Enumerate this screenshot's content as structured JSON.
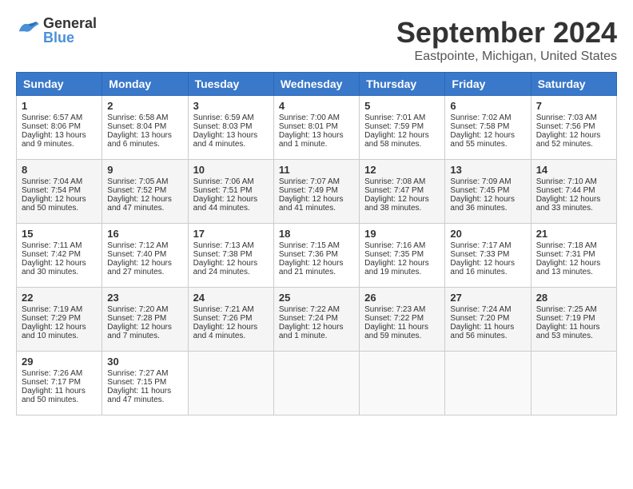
{
  "header": {
    "logo_general": "General",
    "logo_blue": "Blue",
    "month_title": "September 2024",
    "location": "Eastpointe, Michigan, United States"
  },
  "days_of_week": [
    "Sunday",
    "Monday",
    "Tuesday",
    "Wednesday",
    "Thursday",
    "Friday",
    "Saturday"
  ],
  "weeks": [
    [
      {
        "day": "1",
        "sunrise": "Sunrise: 6:57 AM",
        "sunset": "Sunset: 8:06 PM",
        "daylight": "Daylight: 13 hours and 9 minutes."
      },
      {
        "day": "2",
        "sunrise": "Sunrise: 6:58 AM",
        "sunset": "Sunset: 8:04 PM",
        "daylight": "Daylight: 13 hours and 6 minutes."
      },
      {
        "day": "3",
        "sunrise": "Sunrise: 6:59 AM",
        "sunset": "Sunset: 8:03 PM",
        "daylight": "Daylight: 13 hours and 4 minutes."
      },
      {
        "day": "4",
        "sunrise": "Sunrise: 7:00 AM",
        "sunset": "Sunset: 8:01 PM",
        "daylight": "Daylight: 13 hours and 1 minute."
      },
      {
        "day": "5",
        "sunrise": "Sunrise: 7:01 AM",
        "sunset": "Sunset: 7:59 PM",
        "daylight": "Daylight: 12 hours and 58 minutes."
      },
      {
        "day": "6",
        "sunrise": "Sunrise: 7:02 AM",
        "sunset": "Sunset: 7:58 PM",
        "daylight": "Daylight: 12 hours and 55 minutes."
      },
      {
        "day": "7",
        "sunrise": "Sunrise: 7:03 AM",
        "sunset": "Sunset: 7:56 PM",
        "daylight": "Daylight: 12 hours and 52 minutes."
      }
    ],
    [
      {
        "day": "8",
        "sunrise": "Sunrise: 7:04 AM",
        "sunset": "Sunset: 7:54 PM",
        "daylight": "Daylight: 12 hours and 50 minutes."
      },
      {
        "day": "9",
        "sunrise": "Sunrise: 7:05 AM",
        "sunset": "Sunset: 7:52 PM",
        "daylight": "Daylight: 12 hours and 47 minutes."
      },
      {
        "day": "10",
        "sunrise": "Sunrise: 7:06 AM",
        "sunset": "Sunset: 7:51 PM",
        "daylight": "Daylight: 12 hours and 44 minutes."
      },
      {
        "day": "11",
        "sunrise": "Sunrise: 7:07 AM",
        "sunset": "Sunset: 7:49 PM",
        "daylight": "Daylight: 12 hours and 41 minutes."
      },
      {
        "day": "12",
        "sunrise": "Sunrise: 7:08 AM",
        "sunset": "Sunset: 7:47 PM",
        "daylight": "Daylight: 12 hours and 38 minutes."
      },
      {
        "day": "13",
        "sunrise": "Sunrise: 7:09 AM",
        "sunset": "Sunset: 7:45 PM",
        "daylight": "Daylight: 12 hours and 36 minutes."
      },
      {
        "day": "14",
        "sunrise": "Sunrise: 7:10 AM",
        "sunset": "Sunset: 7:44 PM",
        "daylight": "Daylight: 12 hours and 33 minutes."
      }
    ],
    [
      {
        "day": "15",
        "sunrise": "Sunrise: 7:11 AM",
        "sunset": "Sunset: 7:42 PM",
        "daylight": "Daylight: 12 hours and 30 minutes."
      },
      {
        "day": "16",
        "sunrise": "Sunrise: 7:12 AM",
        "sunset": "Sunset: 7:40 PM",
        "daylight": "Daylight: 12 hours and 27 minutes."
      },
      {
        "day": "17",
        "sunrise": "Sunrise: 7:13 AM",
        "sunset": "Sunset: 7:38 PM",
        "daylight": "Daylight: 12 hours and 24 minutes."
      },
      {
        "day": "18",
        "sunrise": "Sunrise: 7:15 AM",
        "sunset": "Sunset: 7:36 PM",
        "daylight": "Daylight: 12 hours and 21 minutes."
      },
      {
        "day": "19",
        "sunrise": "Sunrise: 7:16 AM",
        "sunset": "Sunset: 7:35 PM",
        "daylight": "Daylight: 12 hours and 19 minutes."
      },
      {
        "day": "20",
        "sunrise": "Sunrise: 7:17 AM",
        "sunset": "Sunset: 7:33 PM",
        "daylight": "Daylight: 12 hours and 16 minutes."
      },
      {
        "day": "21",
        "sunrise": "Sunrise: 7:18 AM",
        "sunset": "Sunset: 7:31 PM",
        "daylight": "Daylight: 12 hours and 13 minutes."
      }
    ],
    [
      {
        "day": "22",
        "sunrise": "Sunrise: 7:19 AM",
        "sunset": "Sunset: 7:29 PM",
        "daylight": "Daylight: 12 hours and 10 minutes."
      },
      {
        "day": "23",
        "sunrise": "Sunrise: 7:20 AM",
        "sunset": "Sunset: 7:28 PM",
        "daylight": "Daylight: 12 hours and 7 minutes."
      },
      {
        "day": "24",
        "sunrise": "Sunrise: 7:21 AM",
        "sunset": "Sunset: 7:26 PM",
        "daylight": "Daylight: 12 hours and 4 minutes."
      },
      {
        "day": "25",
        "sunrise": "Sunrise: 7:22 AM",
        "sunset": "Sunset: 7:24 PM",
        "daylight": "Daylight: 12 hours and 1 minute."
      },
      {
        "day": "26",
        "sunrise": "Sunrise: 7:23 AM",
        "sunset": "Sunset: 7:22 PM",
        "daylight": "Daylight: 11 hours and 59 minutes."
      },
      {
        "day": "27",
        "sunrise": "Sunrise: 7:24 AM",
        "sunset": "Sunset: 7:20 PM",
        "daylight": "Daylight: 11 hours and 56 minutes."
      },
      {
        "day": "28",
        "sunrise": "Sunrise: 7:25 AM",
        "sunset": "Sunset: 7:19 PM",
        "daylight": "Daylight: 11 hours and 53 minutes."
      }
    ],
    [
      {
        "day": "29",
        "sunrise": "Sunrise: 7:26 AM",
        "sunset": "Sunset: 7:17 PM",
        "daylight": "Daylight: 11 hours and 50 minutes."
      },
      {
        "day": "30",
        "sunrise": "Sunrise: 7:27 AM",
        "sunset": "Sunset: 7:15 PM",
        "daylight": "Daylight: 11 hours and 47 minutes."
      },
      null,
      null,
      null,
      null,
      null
    ]
  ]
}
